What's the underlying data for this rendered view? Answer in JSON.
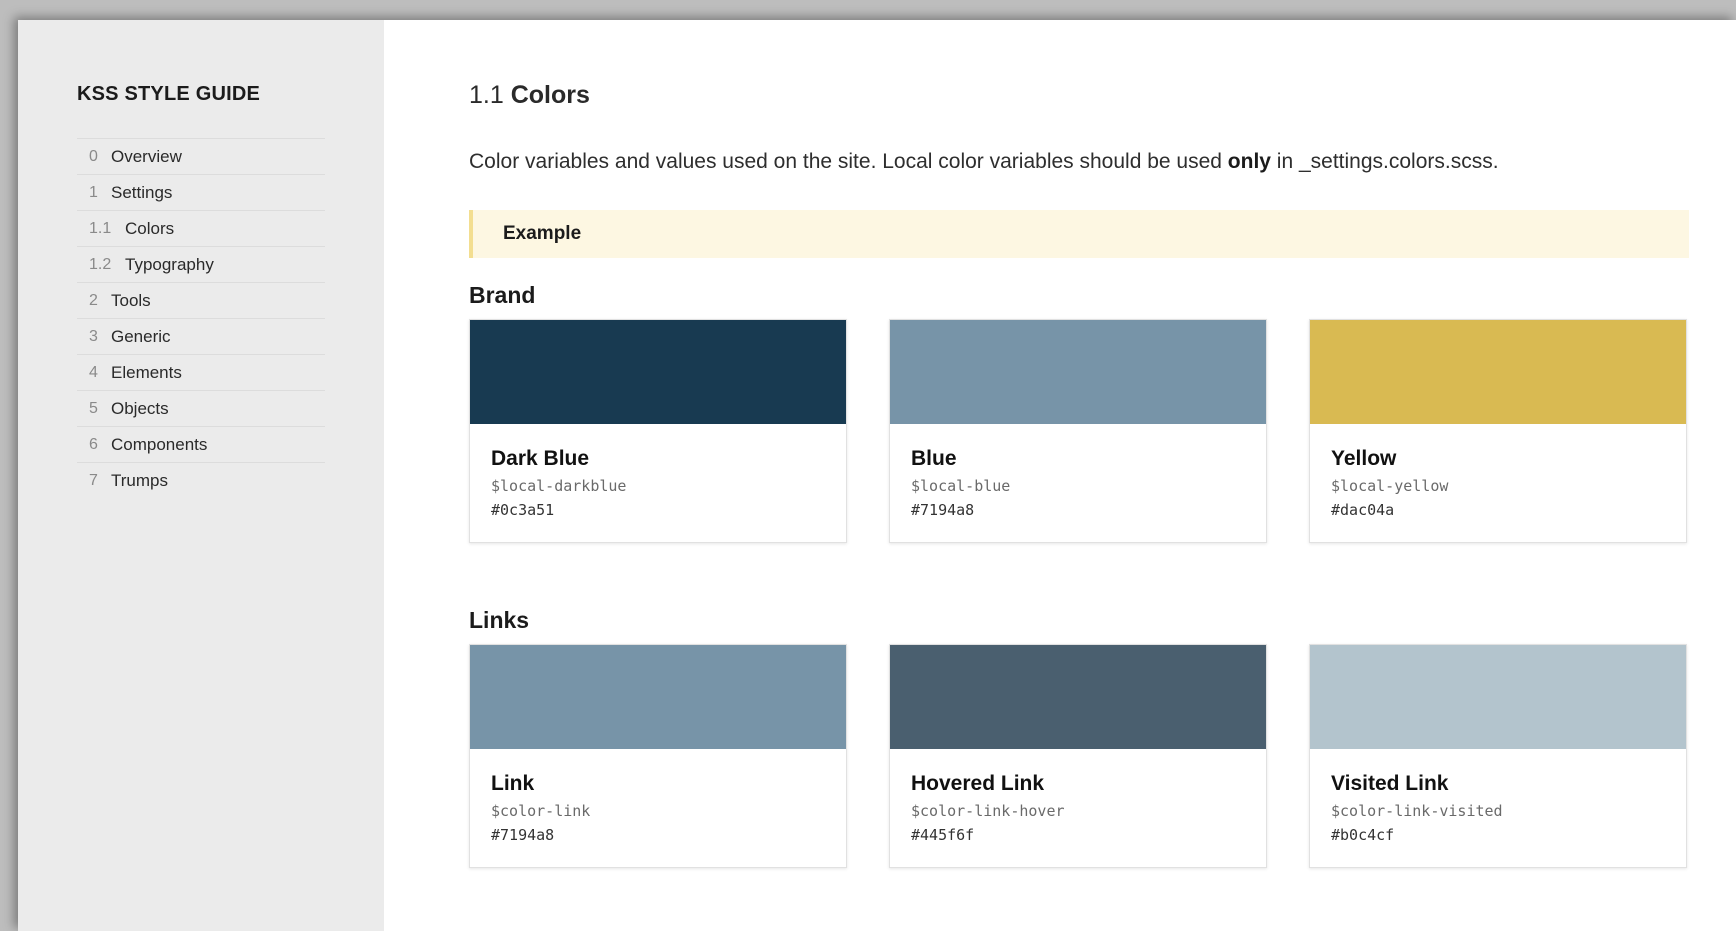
{
  "sidebar": {
    "title": "KSS STYLE GUIDE",
    "items": [
      {
        "num": "0",
        "label": "Overview",
        "sub": false
      },
      {
        "num": "1",
        "label": "Settings",
        "sub": false
      },
      {
        "num": "1.1",
        "label": "Colors",
        "sub": true
      },
      {
        "num": "1.2",
        "label": "Typography",
        "sub": true
      },
      {
        "num": "2",
        "label": "Tools",
        "sub": false
      },
      {
        "num": "3",
        "label": "Generic",
        "sub": false
      },
      {
        "num": "4",
        "label": "Elements",
        "sub": false
      },
      {
        "num": "5",
        "label": "Objects",
        "sub": false
      },
      {
        "num": "6",
        "label": "Components",
        "sub": false
      },
      {
        "num": "7",
        "label": "Trumps",
        "sub": false
      }
    ]
  },
  "main": {
    "section_number": "1.1",
    "section_name": "Colors",
    "description_before": "Color variables and values used on the site. Local color variables should be used ",
    "description_bold": "only",
    "description_after": " in _settings.colors.scss.",
    "example_label": "Example",
    "groups": [
      {
        "title": "Brand",
        "swatches": [
          {
            "name": "Dark Blue",
            "variable": "$local-darkblue",
            "hex": "#0c3a51",
            "color": "#183a51"
          },
          {
            "name": "Blue",
            "variable": "$local-blue",
            "hex": "#7194a8",
            "color": "#7794a8"
          },
          {
            "name": "Yellow",
            "variable": "$local-yellow",
            "hex": "#dac04a",
            "color": "#d9ba52"
          }
        ]
      },
      {
        "title": "Links",
        "swatches": [
          {
            "name": "Link",
            "variable": "$color-link",
            "hex": "#7194a8",
            "color": "#7794a8"
          },
          {
            "name": "Hovered Link",
            "variable": "$color-link-hover",
            "hex": "#445f6f",
            "color": "#4a5f6f"
          },
          {
            "name": "Visited Link",
            "variable": "$color-link-visited",
            "hex": "#b0c4cf",
            "color": "#b3c4cd"
          }
        ]
      }
    ]
  }
}
